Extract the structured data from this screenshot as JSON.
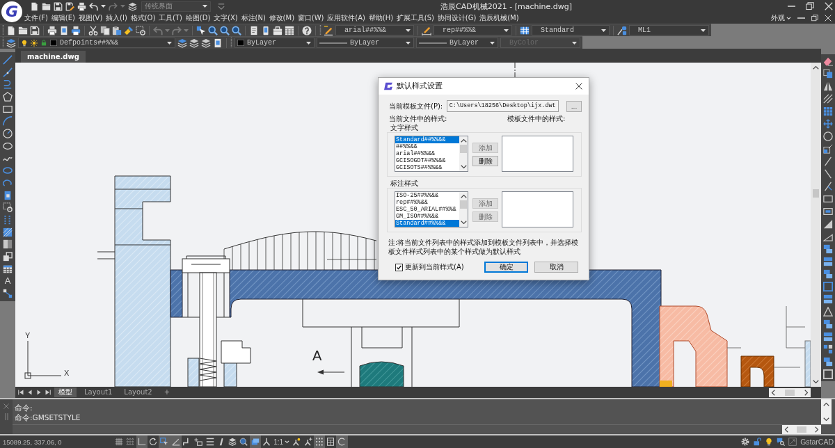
{
  "title_bar": {
    "logo": "G",
    "quick_access": [
      {
        "kind": "undo",
        "disabled": false
      },
      {
        "kind": "redo",
        "disabled": true
      }
    ],
    "workspace": "传统界面",
    "title": "浩辰CAD机械2021 - [machine.dwg]"
  },
  "menu_bar": {
    "items": [
      "文件(F)",
      "编辑(E)",
      "视图(V)",
      "插入(I)",
      "格式(O)",
      "工具(T)",
      "绘图(D)",
      "文字(X)",
      "标注(N)",
      "修改(M)",
      "窗口(W)",
      "应用软件(A)",
      "帮助(H)",
      "扩展工具(S)",
      "协同设计(G)",
      "浩辰机械(M)"
    ],
    "appearance": "外观"
  },
  "standard_toolbar": {
    "history": [
      {
        "kind": "undo",
        "disabled": true
      },
      {
        "kind": "redo",
        "disabled": true
      }
    ],
    "text_style": "arial##%%&",
    "dim_style": "rep##%%&",
    "table_style": "Standard",
    "multileader_style": "ML1"
  },
  "layer_toolbar": {
    "layer": "Defpoints##%%&",
    "color_setting": "ByLayer",
    "linetype": "ByLayer",
    "lineweight": "ByLayer",
    "plot_style": {
      "value": "ByColor",
      "disabled": true
    }
  },
  "draw_toolbar": {
    "text_tool": "A"
  },
  "document_tabs": [
    {
      "label": "machine.dwg",
      "selected": true
    }
  ],
  "drawing": {
    "section_label": "A",
    "ucs": {
      "y_label": "Y",
      "x_label": "X"
    }
  },
  "dialog": {
    "title": "默认样式设置",
    "template_label": "当前模板文件(P):",
    "template_path": "C:\\Users\\18256\\Desktop\\ijx.dwt",
    "browse_button": "...",
    "current_heading": "当前文件中的样式:",
    "template_heading": "模板文件中的样式:",
    "groups": [
      {
        "title": "文字样式",
        "current_styles": [
          {
            "label": "Standard##%%&&",
            "selected": true
          },
          {
            "label": "##%%&&",
            "selected": false
          },
          {
            "label": "arial##%%&&",
            "selected": false
          },
          {
            "label": "GCISOGDT##%%&&",
            "selected": false
          },
          {
            "label": "GCISOTS##%%&&",
            "selected": false
          }
        ],
        "buttons": [
          {
            "label": "添加",
            "disabled": true
          },
          {
            "label": "删除",
            "disabled": false
          }
        ]
      },
      {
        "title": "标注样式",
        "current_styles": [
          {
            "label": "ISO-25##%%&&",
            "selected": false
          },
          {
            "label": "rep##%%&&",
            "selected": false
          },
          {
            "label": "ESC_50_ARIAL##%%&",
            "selected": false
          },
          {
            "label": "GM_ISO##%%&&",
            "selected": false
          },
          {
            "label": "Standard##%%&&",
            "selected": true
          }
        ],
        "buttons": [
          {
            "label": "添加",
            "disabled": true
          },
          {
            "label": "删除",
            "disabled": true
          }
        ]
      }
    ],
    "note": "注:将当前文件列表中的样式添加到模板文件列表中，并选择模板文件样式列表中的某个样式做为默认样式",
    "update_checkbox": {
      "label": "更新到当前样式(A)",
      "checked": true
    },
    "buttons": [
      {
        "label": "确定",
        "default": true
      },
      {
        "label": "取消",
        "default": false
      }
    ]
  },
  "layout_tabs": {
    "tabs": [
      {
        "label": "模型",
        "selected": true
      },
      {
        "label": "Layout1",
        "selected": false
      },
      {
        "label": "Layout2",
        "selected": false
      }
    ],
    "new_tab": "+"
  },
  "command_line": {
    "lines": [
      "命令:",
      "命令:GMSETSTYLE"
    ]
  },
  "status_bar": {
    "coordinates": "15089.25, 337.06, 0",
    "toggles": [
      {
        "kind": "grid",
        "on": false
      },
      {
        "kind": "snap",
        "on": false
      },
      {
        "kind": "ortho",
        "on": true
      },
      {
        "kind": "polar",
        "on": false
      },
      {
        "kind": "osnap",
        "on": true
      },
      {
        "kind": "otrack",
        "on": true
      },
      {
        "kind": "ducs",
        "on": false
      },
      {
        "kind": "dyn",
        "on": false
      },
      {
        "kind": "lineweight",
        "on": false
      },
      {
        "kind": "transparency",
        "on": false
      },
      {
        "kind": "layers",
        "on": false
      },
      {
        "kind": "quickprops",
        "on": false
      },
      {
        "kind": "cycling",
        "on": true
      },
      {
        "kind": "annotation",
        "on": false
      }
    ],
    "annotation_scale": "1:1",
    "annotation_toggles": [
      {
        "kind": "visibility",
        "on": false
      },
      {
        "kind": "autoscale",
        "on": false
      },
      {
        "kind": "hardware",
        "on": true
      },
      {
        "kind": "calculator",
        "on": false
      },
      {
        "kind": "cleanscreen",
        "on": true
      }
    ],
    "product": "GstarCAD"
  }
}
